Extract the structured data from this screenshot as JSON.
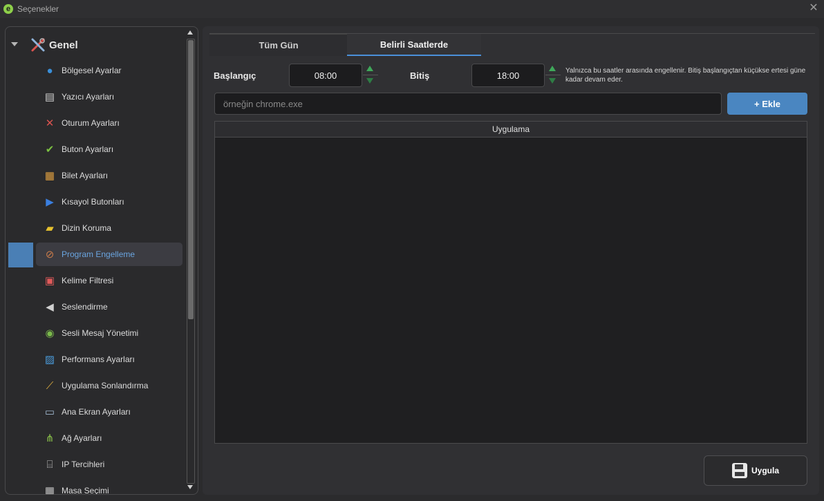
{
  "window": {
    "title": "Seçenekler",
    "logo_letter": "e"
  },
  "sidebar": {
    "root": {
      "label": "Genel"
    },
    "items": [
      {
        "label": "Bölgesel Ayarlar",
        "icon": "globe-icon",
        "name": "sidebar-item-bolgesel-ayarlar"
      },
      {
        "label": "Yazıcı Ayarları",
        "icon": "printer-icon",
        "name": "sidebar-item-yazici-ayarlari"
      },
      {
        "label": "Oturum Ayarları",
        "icon": "tools-icon",
        "name": "sidebar-item-oturum-ayarlari"
      },
      {
        "label": "Buton Ayarları",
        "icon": "checkmark-icon",
        "name": "sidebar-item-buton-ayarlari"
      },
      {
        "label": "Bilet Ayarları",
        "icon": "ticket-icon",
        "name": "sidebar-item-bilet-ayarlari"
      },
      {
        "label": "Kısayol Butonları",
        "icon": "play-icon",
        "name": "sidebar-item-kisayol-butonlari"
      },
      {
        "label": "Dizin Koruma",
        "icon": "folder-shield-icon",
        "name": "sidebar-item-dizin-koruma"
      },
      {
        "label": "Program Engelleme",
        "icon": "block-icon",
        "name": "sidebar-item-program-engelleme"
      },
      {
        "label": "Kelime Filtresi",
        "icon": "filter-icon",
        "name": "sidebar-item-kelime-filtresi"
      },
      {
        "label": "Seslendirme",
        "icon": "speaker-icon",
        "name": "sidebar-item-seslendirme"
      },
      {
        "label": "Sesli Mesaj Yönetimi",
        "icon": "voice-message-icon",
        "name": "sidebar-item-sesli-mesaj"
      },
      {
        "label": "Performans Ayarları",
        "icon": "chart-icon",
        "name": "sidebar-item-performans-ayarlari"
      },
      {
        "label": "Uygulama Sonlandırma",
        "icon": "broom-icon",
        "name": "sidebar-item-uygulama-sonlandirma"
      },
      {
        "label": "Ana Ekran Ayarları",
        "icon": "monitor-icon",
        "name": "sidebar-item-ana-ekran-ayarlari"
      },
      {
        "label": "Ağ Ayarları",
        "icon": "network-icon",
        "name": "sidebar-item-ag-ayarlari"
      },
      {
        "label": "IP Tercihleri",
        "icon": "ip-icon",
        "name": "sidebar-item-ip-tercihleri"
      },
      {
        "label": "Masa Seçimi",
        "icon": "grid-icon",
        "name": "sidebar-item-masa"
      }
    ],
    "active_index": 7
  },
  "tabs": [
    {
      "label": "Tüm Gün",
      "active": false
    },
    {
      "label": "Belirli Saatlerde",
      "active": true
    }
  ],
  "time": {
    "start_label": "Başlangıç",
    "start_value": "08:00",
    "end_label": "Bitiş",
    "end_value": "18:00",
    "hint": "Yalnızca bu saatler arasında engellenir. Bitiş başlangıçtan küçükse ertesi güne kadar devam eder."
  },
  "app_input": {
    "placeholder": "örneğin chrome.exe",
    "value": ""
  },
  "add_button": {
    "label": "+ Ekle"
  },
  "table": {
    "header": "Uygulama",
    "rows": []
  },
  "apply_button": {
    "label": "Uygula"
  },
  "colors": {
    "accent": "#4a86c1",
    "tab_underline": "#4a90d9",
    "active_text": "#6aa5e0",
    "spin_green": "#3fa85a"
  }
}
